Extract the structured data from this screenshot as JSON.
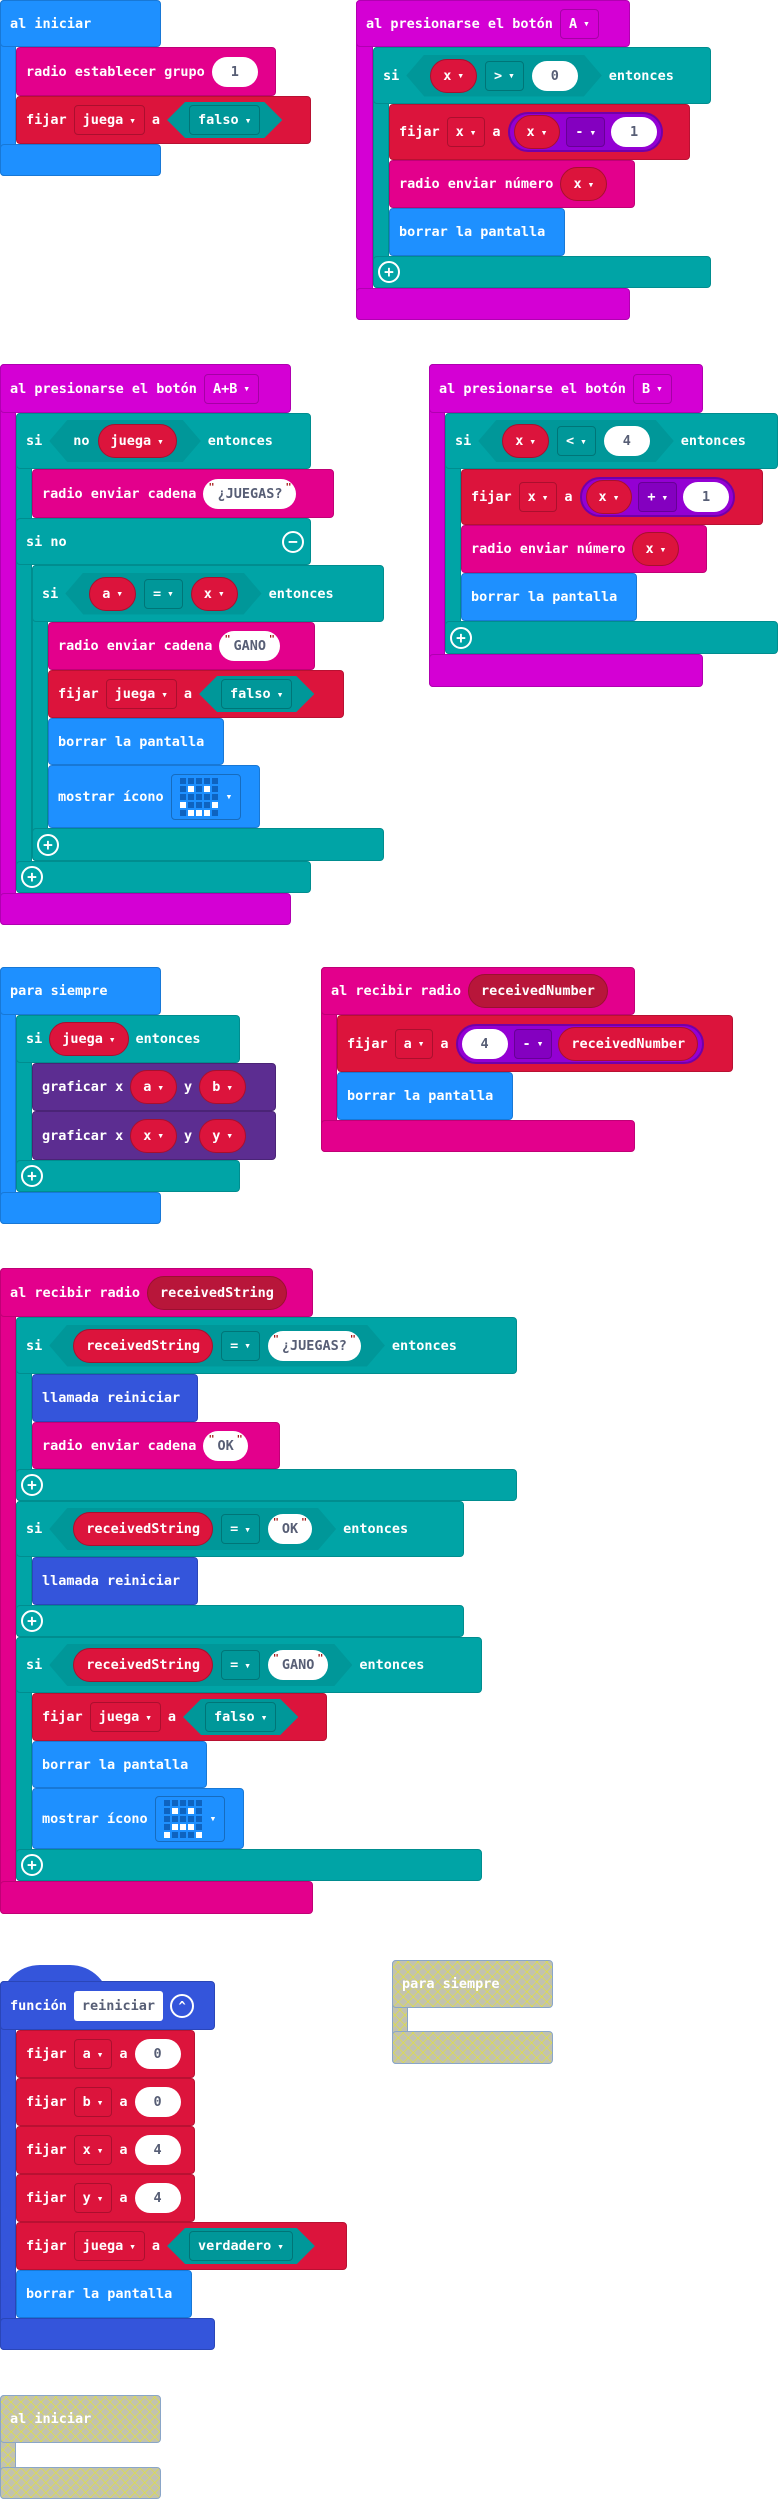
{
  "on_start": {
    "title": "al iniciar",
    "radio_group": {
      "label": "radio establecer grupo",
      "value": "1"
    },
    "set_juega": {
      "label": "fijar",
      "var": "juega",
      "to": "a",
      "value": "falso"
    }
  },
  "button_a": {
    "title": "al presionarse el botón",
    "button": "A",
    "if": {
      "label": "si",
      "var": "x",
      "op": ">",
      "value": "0",
      "then": "entonces"
    },
    "set_x": {
      "label": "fijar",
      "var": "x",
      "to": "a",
      "lhs": "x",
      "op": "-",
      "rhs": "1"
    },
    "send_number": {
      "label": "radio enviar número",
      "var": "x"
    },
    "clear": "borrar la pantalla"
  },
  "button_ab": {
    "title": "al presionarse el botón",
    "button": "A+B",
    "if": {
      "label": "si",
      "not": "no",
      "var": "juega",
      "then": "entonces"
    },
    "send_string": {
      "label": "radio enviar cadena",
      "value": "¿JUEGAS?"
    },
    "else": "si no",
    "inner_if": {
      "label": "si",
      "lhs": "a",
      "op": "=",
      "rhs": "x",
      "then": "entonces"
    },
    "send_gano": {
      "label": "radio enviar cadena",
      "value": "GANO"
    },
    "set_juega": {
      "label": "fijar",
      "var": "juega",
      "to": "a",
      "value": "falso"
    },
    "clear": "borrar la pantalla",
    "show_icon": {
      "label": "mostrar ícono",
      "icon": "happy",
      "pattern": [
        "00000",
        "01010",
        "00000",
        "10001",
        "01110"
      ]
    }
  },
  "button_b": {
    "title": "al presionarse el botón",
    "button": "B",
    "if": {
      "label": "si",
      "var": "x",
      "op": "<",
      "value": "4",
      "then": "entonces"
    },
    "set_x": {
      "label": "fijar",
      "var": "x",
      "to": "a",
      "lhs": "x",
      "op": "+",
      "rhs": "1"
    },
    "send_number": {
      "label": "radio enviar número",
      "var": "x"
    },
    "clear": "borrar la pantalla"
  },
  "forever": {
    "title": "para siempre",
    "if": {
      "label": "si",
      "var": "juega",
      "then": "entonces"
    },
    "plot1": {
      "label": "graficar x",
      "x": "a",
      "y_label": "y",
      "y": "b"
    },
    "plot2": {
      "label": "graficar x",
      "x": "x",
      "y_label": "y",
      "y": "y"
    }
  },
  "recv_number": {
    "title": "al recibir radio",
    "param": "receivedNumber",
    "set_a": {
      "label": "fijar",
      "var": "a",
      "to": "a",
      "lhs": "4",
      "op": "-",
      "rhs": "receivedNumber"
    },
    "clear": "borrar la pantalla"
  },
  "recv_string": {
    "title": "al recibir radio",
    "param": "receivedString",
    "if1": {
      "label": "si",
      "var": "receivedString",
      "op": "=",
      "value": "¿JUEGAS?",
      "then": "entonces"
    },
    "call1": "llamada reiniciar",
    "send_ok": {
      "label": "radio enviar cadena",
      "value": "OK"
    },
    "if2": {
      "label": "si",
      "var": "receivedString",
      "op": "=",
      "value": "OK",
      "then": "entonces"
    },
    "call2": "llamada reiniciar",
    "if3": {
      "label": "si",
      "var": "receivedString",
      "op": "=",
      "value": "GANO",
      "then": "entonces"
    },
    "set_juega": {
      "label": "fijar",
      "var": "juega",
      "to": "a",
      "value": "falso"
    },
    "clear": "borrar la pantalla",
    "show_icon": {
      "label": "mostrar ícono",
      "icon": "sad",
      "pattern": [
        "00000",
        "01010",
        "00000",
        "01110",
        "10001"
      ]
    }
  },
  "function": {
    "label": "función",
    "name": "reiniciar",
    "sets": [
      {
        "label": "fijar",
        "var": "a",
        "to": "a",
        "value": "0"
      },
      {
        "label": "fijar",
        "var": "b",
        "to": "a",
        "value": "0"
      },
      {
        "label": "fijar",
        "var": "x",
        "to": "a",
        "value": "4"
      },
      {
        "label": "fijar",
        "var": "y",
        "to": "a",
        "value": "4"
      }
    ],
    "set_juega": {
      "label": "fijar",
      "var": "juega",
      "to": "a",
      "value": "verdadero"
    },
    "clear": "borrar la pantalla"
  },
  "disabled_forever": {
    "title": "para siempre"
  },
  "disabled_on_start": {
    "title": "al iniciar"
  },
  "caret": "▾"
}
